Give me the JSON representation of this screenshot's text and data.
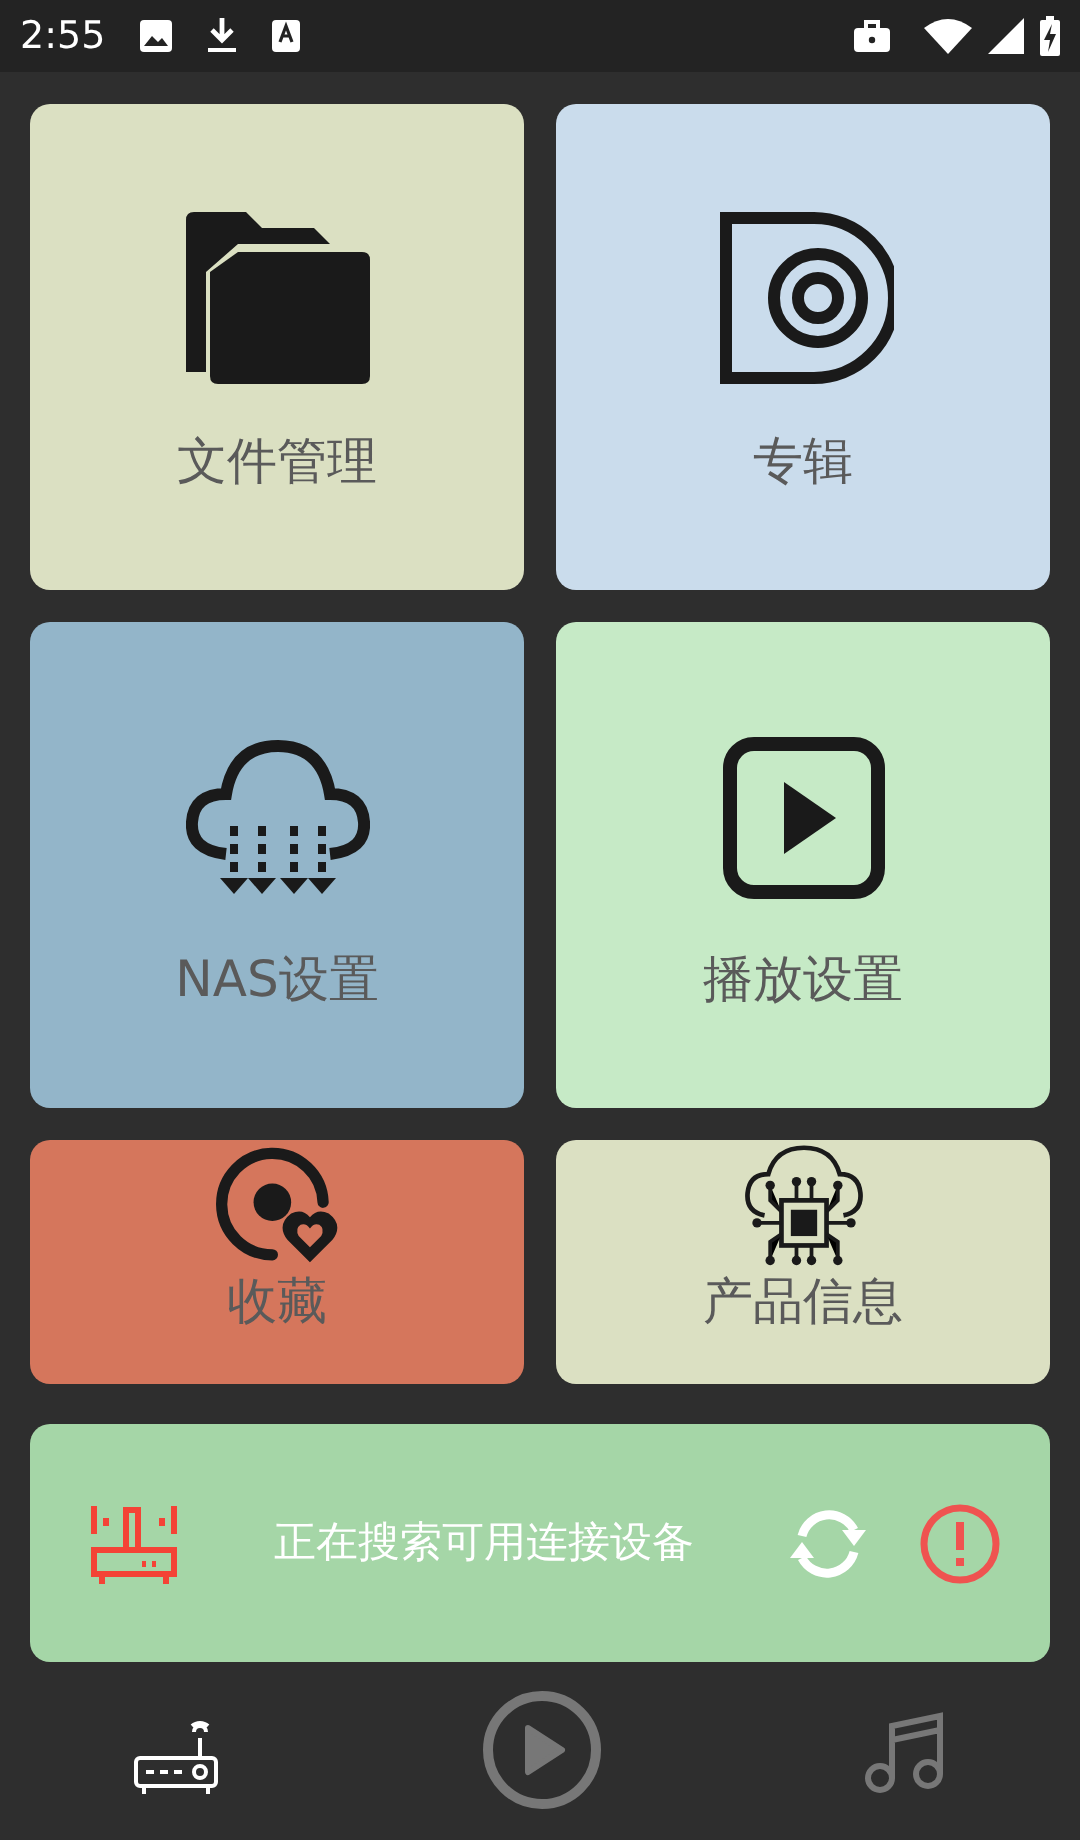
{
  "status_bar": {
    "time": "2:55"
  },
  "tiles": [
    {
      "label": "文件管理",
      "kind": "folder",
      "color": "#dbe0c2"
    },
    {
      "label": "专辑",
      "kind": "disc",
      "color": "#cadcec"
    },
    {
      "label": "NAS设置",
      "kind": "cloud",
      "color": "#93b5c9"
    },
    {
      "label": "播放设置",
      "kind": "play",
      "color": "#c6eac6"
    },
    {
      "label": "收藏",
      "kind": "favorite",
      "color": "#d5765c"
    },
    {
      "label": "产品信息",
      "kind": "chip",
      "color": "#dbe0c2"
    }
  ],
  "banner": {
    "message": "正在搜索可用连接设备"
  },
  "bottom_nav": [
    {
      "kind": "device",
      "selected": true
    },
    {
      "kind": "player",
      "selected": false
    },
    {
      "kind": "music",
      "selected": false
    }
  ]
}
